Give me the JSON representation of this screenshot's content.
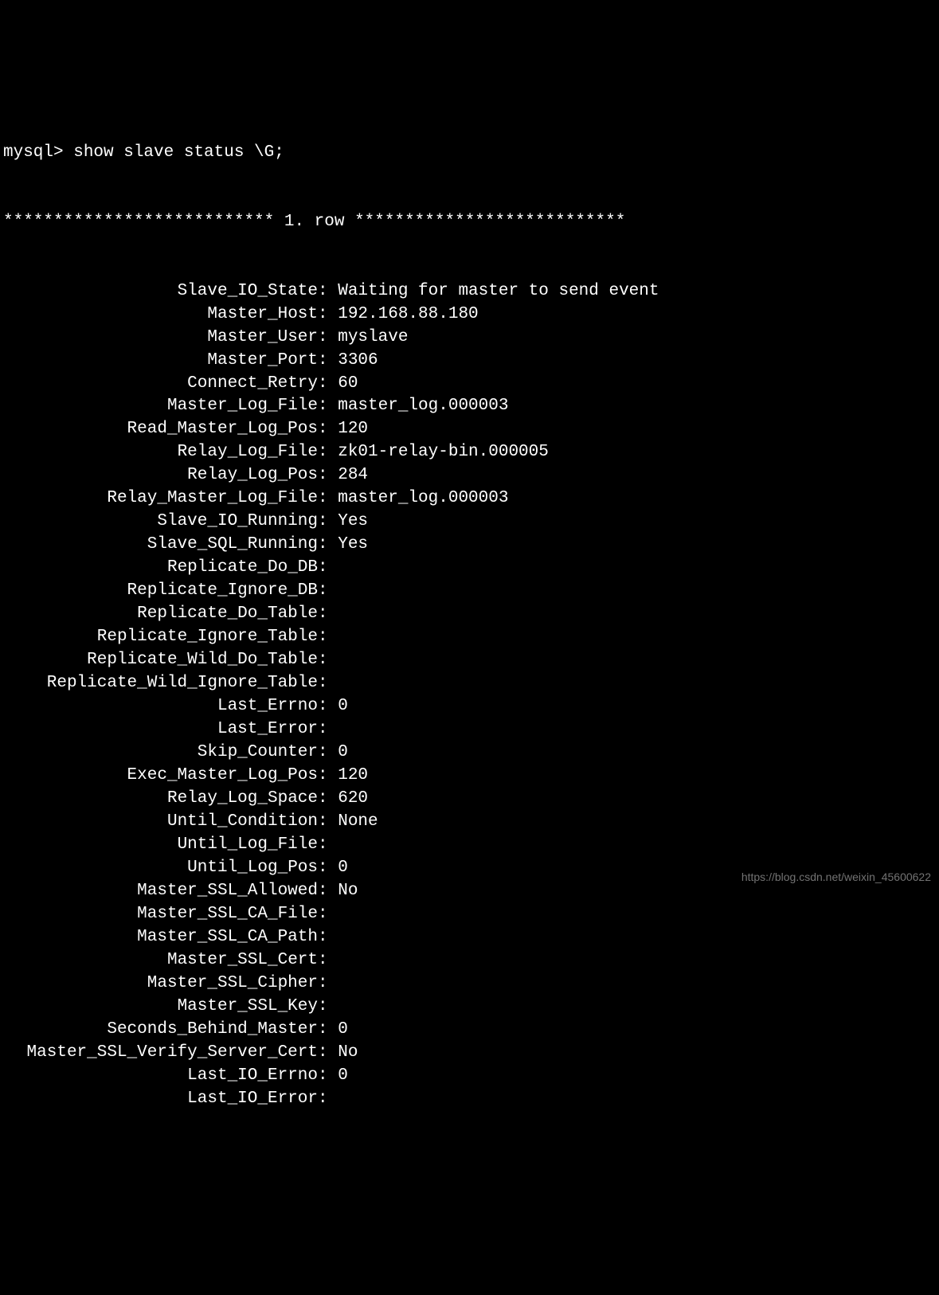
{
  "prompt": "mysql> show slave status \\G;",
  "row_header": "*************************** 1. row ***************************",
  "fields": [
    {
      "key": "Slave_IO_State",
      "val": "Waiting for master to send event"
    },
    {
      "key": "Master_Host",
      "val": "192.168.88.180"
    },
    {
      "key": "Master_User",
      "val": "myslave"
    },
    {
      "key": "Master_Port",
      "val": "3306"
    },
    {
      "key": "Connect_Retry",
      "val": "60"
    },
    {
      "key": "Master_Log_File",
      "val": "master_log.000003"
    },
    {
      "key": "Read_Master_Log_Pos",
      "val": "120"
    },
    {
      "key": "Relay_Log_File",
      "val": "zk01-relay-bin.000005"
    },
    {
      "key": "Relay_Log_Pos",
      "val": "284"
    },
    {
      "key": "Relay_Master_Log_File",
      "val": "master_log.000003"
    },
    {
      "key": "Slave_IO_Running",
      "val": "Yes"
    },
    {
      "key": "Slave_SQL_Running",
      "val": "Yes"
    },
    {
      "key": "Replicate_Do_DB",
      "val": ""
    },
    {
      "key": "Replicate_Ignore_DB",
      "val": ""
    },
    {
      "key": "Replicate_Do_Table",
      "val": ""
    },
    {
      "key": "Replicate_Ignore_Table",
      "val": ""
    },
    {
      "key": "Replicate_Wild_Do_Table",
      "val": ""
    },
    {
      "key": "Replicate_Wild_Ignore_Table",
      "val": ""
    },
    {
      "key": "Last_Errno",
      "val": "0"
    },
    {
      "key": "Last_Error",
      "val": ""
    },
    {
      "key": "Skip_Counter",
      "val": "0"
    },
    {
      "key": "Exec_Master_Log_Pos",
      "val": "120"
    },
    {
      "key": "Relay_Log_Space",
      "val": "620"
    },
    {
      "key": "Until_Condition",
      "val": "None"
    },
    {
      "key": "Until_Log_File",
      "val": ""
    },
    {
      "key": "Until_Log_Pos",
      "val": "0"
    },
    {
      "key": "Master_SSL_Allowed",
      "val": "No"
    },
    {
      "key": "Master_SSL_CA_File",
      "val": ""
    },
    {
      "key": "Master_SSL_CA_Path",
      "val": ""
    },
    {
      "key": "Master_SSL_Cert",
      "val": ""
    },
    {
      "key": "Master_SSL_Cipher",
      "val": ""
    },
    {
      "key": "Master_SSL_Key",
      "val": ""
    },
    {
      "key": "Seconds_Behind_Master",
      "val": "0"
    },
    {
      "key": "Master_SSL_Verify_Server_Cert",
      "val": "No"
    },
    {
      "key": "Last_IO_Errno",
      "val": "0"
    },
    {
      "key": "Last_IO_Error",
      "val": ""
    }
  ],
  "watermark": "https://blog.csdn.net/weixin_45600622"
}
